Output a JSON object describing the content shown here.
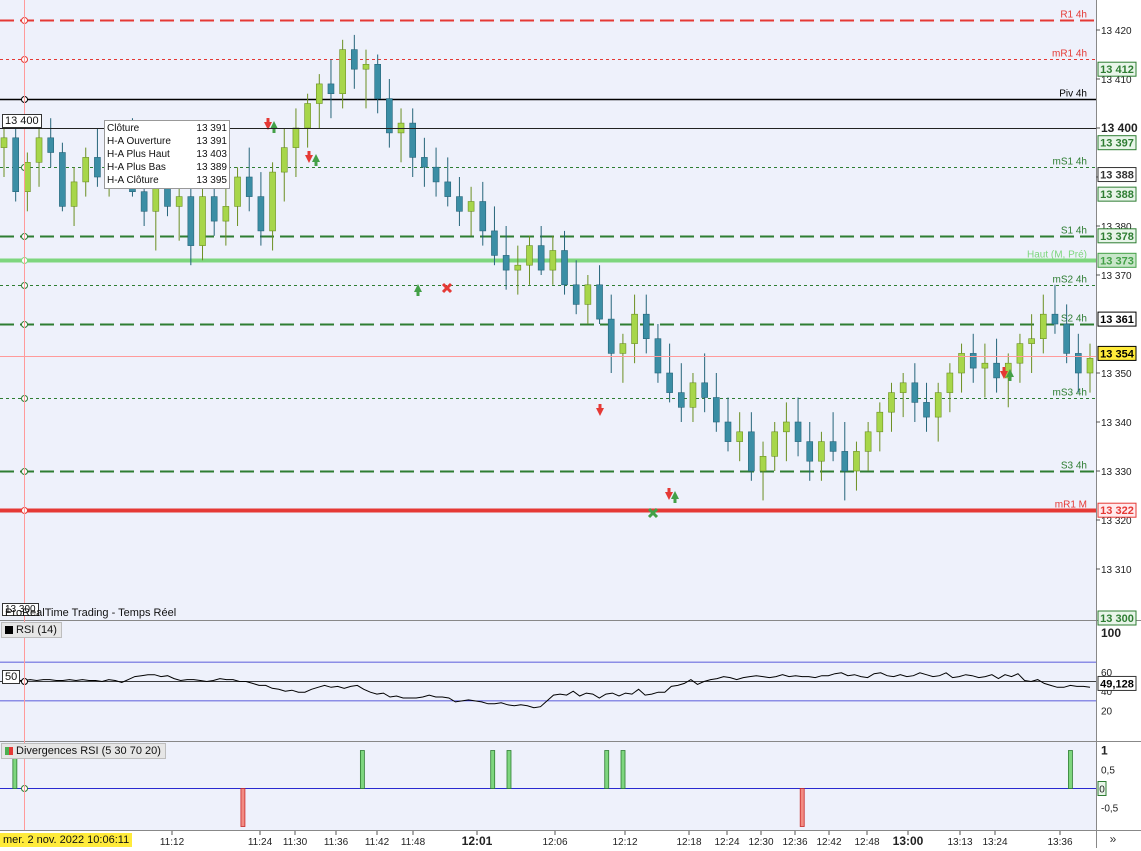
{
  "price_axis": {
    "ticks": [
      "13 420",
      "13 410",
      "13 400",
      "13 390",
      "13 380",
      "13 370",
      "13 350",
      "13 340",
      "13 330",
      "13 320",
      "13 310"
    ],
    "bold_tick": "13 400",
    "tags": [
      {
        "text": "13 412",
        "color": "#2e7d32",
        "bg": "#e8f5e9",
        "price": 13412
      },
      {
        "text": "13 397",
        "color": "#2e7d32",
        "bg": "#e8f5e9",
        "price": 13397
      },
      {
        "text": "13 388",
        "color": "#333333",
        "bg": "#ffffff",
        "price": 13390.5
      },
      {
        "text": "13 388",
        "color": "#2e7d32",
        "bg": "#e8f5e9",
        "price": 13386.5
      },
      {
        "text": "13 378",
        "color": "#2e7d32",
        "bg": "#e8f5e9",
        "price": 13378
      },
      {
        "text": "13 373",
        "color": "#43a047",
        "bg": "#c8e6c9",
        "price": 13373
      },
      {
        "text": "13 361",
        "color": "#000000",
        "bg": "#ffffff",
        "price": 13361
      },
      {
        "text": "13 354",
        "color": "#000000",
        "bg": "#ffeb3b",
        "price": 13354
      },
      {
        "text": "13 322",
        "color": "#e53935",
        "bg": "#ffebee",
        "price": 13322
      },
      {
        "text": "13 300",
        "color": "#2e7d32",
        "bg": "#e8f5e9",
        "price": 13300
      }
    ],
    "left_box": "13 400",
    "left_box_bottom": "13 300"
  },
  "levels": [
    {
      "label": "R1 4h",
      "price": 13422,
      "color": "#e53935",
      "style": "dashed-long",
      "width": 2
    },
    {
      "label": "mR1 4h",
      "price": 13414,
      "color": "#e53935",
      "style": "dotted",
      "width": 1
    },
    {
      "label": "Piv 4h",
      "price": 13406,
      "color": "#000000",
      "style": "solid",
      "width": 1.5
    },
    {
      "label": "mS1 4h",
      "price": 13392,
      "color": "#2e7d32",
      "style": "dotted",
      "width": 1
    },
    {
      "label": "S1 4h",
      "price": 13378,
      "color": "#2e7d32",
      "style": "dashed-long",
      "width": 2
    },
    {
      "label": "Haut (M, Pré)",
      "price": 13373,
      "color": "#7ed67e",
      "style": "solid",
      "width": 4
    },
    {
      "label": "mS2 4h",
      "price": 13368,
      "color": "#2e7d32",
      "style": "dotted",
      "width": 1
    },
    {
      "label": "S2 4h",
      "price": 13360,
      "color": "#2e7d32",
      "style": "dashed-long",
      "width": 2
    },
    {
      "label": "mS3 4h",
      "price": 13345,
      "color": "#2e7d32",
      "style": "dotted",
      "width": 1
    },
    {
      "label": "S3 4h",
      "price": 13330,
      "color": "#2e7d32",
      "style": "dashed-long",
      "width": 2
    },
    {
      "label": "mR1 M",
      "price": 13322,
      "color": "#e53935",
      "style": "solid",
      "width": 4
    }
  ],
  "tooltip": {
    "rows": [
      {
        "label": "Clôture",
        "value": "13 391"
      },
      {
        "label": "H-A Ouverture",
        "value": "13 391"
      },
      {
        "label": "H-A Plus Haut",
        "value": "13 403"
      },
      {
        "label": "H-A Plus Bas",
        "value": "13 389"
      },
      {
        "label": "H-A Clôture",
        "value": "13 395"
      }
    ]
  },
  "source_label": "ProRealTime Trading - Temps Réel",
  "rsi_panel": {
    "title": "RSI (14)",
    "ticks": [
      "100",
      "60",
      "40",
      "20"
    ],
    "left_box": "50",
    "current_value": "49,128",
    "overbought": 70,
    "oversold": 30,
    "midline": 50,
    "values": [
      51,
      50,
      51,
      51,
      52,
      51,
      52,
      52,
      51,
      51,
      52,
      51,
      52,
      51,
      51,
      50,
      52,
      51,
      49,
      52,
      55,
      56,
      57,
      57,
      55,
      56,
      53,
      51,
      52,
      52,
      51,
      50,
      51,
      53,
      52,
      52,
      50,
      50,
      48,
      46,
      46,
      43,
      42,
      40,
      41,
      39,
      39,
      42,
      44,
      46,
      44,
      45,
      43,
      45,
      46,
      42,
      39,
      37,
      38,
      34,
      35,
      33,
      33,
      33,
      34,
      36,
      34,
      34,
      33,
      29,
      30,
      31,
      30,
      29,
      27,
      27,
      28,
      26,
      25,
      26,
      25,
      23,
      24,
      30,
      36,
      37,
      36,
      40,
      35,
      38,
      37,
      33,
      37,
      38,
      35,
      38,
      37,
      42,
      36,
      37,
      39,
      39,
      45,
      46,
      48,
      52,
      47,
      50,
      52,
      53,
      55,
      54,
      52,
      54,
      55,
      56,
      55,
      54,
      55,
      57,
      55,
      56,
      55,
      55,
      54,
      56,
      56,
      58,
      59,
      56,
      57,
      55,
      54,
      58,
      59,
      56,
      55,
      57,
      55,
      56,
      59,
      57,
      55,
      56,
      59,
      54,
      55,
      57,
      56,
      54,
      55,
      57,
      53,
      57,
      55,
      58,
      51,
      50,
      52,
      48,
      46,
      44,
      44,
      46,
      45,
      45,
      44
    ]
  },
  "div_panel": {
    "title": "Divergences RSI (5 30 70 20)",
    "ticks": [
      "1",
      "0,5",
      "-0,5"
    ],
    "zero_box": "0",
    "bullish_times": [
      0.01,
      0.33,
      0.45,
      0.465,
      0.555,
      0.57,
      0.982
    ],
    "bearish_times": [
      0.22,
      0.735
    ]
  },
  "time_axis": {
    "ticks": [
      {
        "label": "11:12",
        "bold": false
      },
      {
        "label": "11:24",
        "bold": false
      },
      {
        "label": "11:30",
        "bold": false
      },
      {
        "label": "11:36",
        "bold": false
      },
      {
        "label": "11:42",
        "bold": false
      },
      {
        "label": "11:48",
        "bold": false
      },
      {
        "label": "12:01",
        "bold": true
      },
      {
        "label": "12:06",
        "bold": false
      },
      {
        "label": "12:12",
        "bold": false
      },
      {
        "label": "12:18",
        "bold": false
      },
      {
        "label": "12:24",
        "bold": false
      },
      {
        "label": "12:30",
        "bold": false
      },
      {
        "label": "12:36",
        "bold": false
      },
      {
        "label": "12:42",
        "bold": false
      },
      {
        "label": "12:48",
        "bold": false
      },
      {
        "label": "13:00",
        "bold": true
      },
      {
        "label": "13:13",
        "bold": false
      },
      {
        "label": "13:24",
        "bold": false
      },
      {
        "label": "13:36",
        "bold": false
      }
    ],
    "cursor_date": "mer. 2 nov. 2022 10:06:11",
    "more_label": "»"
  },
  "candles": [
    [
      13396,
      13401,
      13390,
      13398
    ],
    [
      13398,
      13400,
      13385,
      13387
    ],
    [
      13387,
      13395,
      13383,
      13393
    ],
    [
      13393,
      13400,
      13388,
      13398
    ],
    [
      13398,
      13402,
      13392,
      13395
    ],
    [
      13395,
      13397,
      13383,
      13384
    ],
    [
      13384,
      13392,
      13380,
      13389
    ],
    [
      13389,
      13396,
      13386,
      13394
    ],
    [
      13394,
      13400,
      13388,
      13390
    ],
    [
      13390,
      13398,
      13386,
      13396
    ],
    [
      13396,
      13401,
      13392,
      13399
    ],
    [
      13399,
      13402,
      13386,
      13387
    ],
    [
      13387,
      13392,
      13380,
      13383
    ],
    [
      13383,
      13390,
      13375,
      13388
    ],
    [
      13388,
      13392,
      13382,
      13384
    ],
    [
      13384,
      13390,
      13377,
      13386
    ],
    [
      13386,
      13392,
      13372,
      13376
    ],
    [
      13376,
      13388,
      13373,
      13386
    ],
    [
      13386,
      13392,
      13378,
      13381
    ],
    [
      13381,
      13388,
      13376,
      13384
    ],
    [
      13384,
      13392,
      13380,
      13390
    ],
    [
      13390,
      13396,
      13383,
      13386
    ],
    [
      13386,
      13391,
      13376,
      13379
    ],
    [
      13379,
      13393,
      13375,
      13391
    ],
    [
      13391,
      13400,
      13385,
      13396
    ],
    [
      13396,
      13404,
      13390,
      13400
    ],
    [
      13400,
      13407,
      13396,
      13405
    ],
    [
      13405,
      13411,
      13400,
      13409
    ],
    [
      13409,
      13414,
      13402,
      13407
    ],
    [
      13407,
      13418,
      13404,
      13416
    ],
    [
      13416,
      13419,
      13408,
      13412
    ],
    [
      13412,
      13416,
      13404,
      13413
    ],
    [
      13413,
      13415,
      13403,
      13406
    ],
    [
      13406,
      13410,
      13396,
      13399
    ],
    [
      13399,
      13404,
      13393,
      13401
    ],
    [
      13401,
      13404,
      13390,
      13394
    ],
    [
      13394,
      13398,
      13388,
      13392
    ],
    [
      13392,
      13396,
      13386,
      13389
    ],
    [
      13389,
      13394,
      13384,
      13386
    ],
    [
      13386,
      13390,
      13380,
      13383
    ],
    [
      13383,
      13388,
      13378,
      13385
    ],
    [
      13385,
      13389,
      13376,
      13379
    ],
    [
      13379,
      13384,
      13372,
      13374
    ],
    [
      13374,
      13380,
      13367,
      13371
    ],
    [
      13371,
      13376,
      13366,
      13372
    ],
    [
      13372,
      13378,
      13368,
      13376
    ],
    [
      13376,
      13380,
      13370,
      13371
    ],
    [
      13371,
      13378,
      13368,
      13375
    ],
    [
      13375,
      13379,
      13366,
      13368
    ],
    [
      13368,
      13373,
      13362,
      13364
    ],
    [
      13364,
      13370,
      13360,
      13368
    ],
    [
      13368,
      13372,
      13360,
      13361
    ],
    [
      13361,
      13366,
      13350,
      13354
    ],
    [
      13354,
      13358,
      13348,
      13356
    ],
    [
      13356,
      13366,
      13352,
      13362
    ],
    [
      13362,
      13366,
      13354,
      13357
    ],
    [
      13357,
      13360,
      13348,
      13350
    ],
    [
      13350,
      13356,
      13344,
      13346
    ],
    [
      13346,
      13352,
      13340,
      13343
    ],
    [
      13343,
      13350,
      13340,
      13348
    ],
    [
      13348,
      13354,
      13342,
      13345
    ],
    [
      13345,
      13350,
      13338,
      13340
    ],
    [
      13340,
      13345,
      13334,
      13336
    ],
    [
      13336,
      13342,
      13332,
      13338
    ],
    [
      13338,
      13342,
      13328,
      13330
    ],
    [
      13330,
      13336,
      13324,
      13333
    ],
    [
      13333,
      13340,
      13330,
      13338
    ],
    [
      13338,
      13344,
      13332,
      13340
    ],
    [
      13340,
      13345,
      13333,
      13336
    ],
    [
      13336,
      13340,
      13328,
      13332
    ],
    [
      13332,
      13338,
      13328,
      13336
    ],
    [
      13336,
      13342,
      13332,
      13334
    ],
    [
      13334,
      13340,
      13324,
      13330
    ],
    [
      13330,
      13336,
      13326,
      13334
    ],
    [
      13334,
      13340,
      13330,
      13338
    ],
    [
      13338,
      13344,
      13334,
      13342
    ],
    [
      13342,
      13348,
      13338,
      13346
    ],
    [
      13346,
      13350,
      13341,
      13348
    ],
    [
      13348,
      13352,
      13340,
      13344
    ],
    [
      13344,
      13348,
      13338,
      13341
    ],
    [
      13341,
      13348,
      13336,
      13346
    ],
    [
      13346,
      13352,
      13342,
      13350
    ],
    [
      13350,
      13356,
      13346,
      13354
    ],
    [
      13354,
      13358,
      13348,
      13351
    ],
    [
      13351,
      13356,
      13345,
      13352
    ],
    [
      13352,
      13357,
      13346,
      13349
    ],
    [
      13349,
      13354,
      13343,
      13352
    ],
    [
      13352,
      13358,
      13348,
      13356
    ],
    [
      13356,
      13362,
      13350,
      13357
    ],
    [
      13357,
      13366,
      13354,
      13362
    ],
    [
      13362,
      13368,
      13358,
      13360
    ],
    [
      13360,
      13364,
      13352,
      13354
    ],
    [
      13354,
      13358,
      13346,
      13350
    ],
    [
      13350,
      13356,
      13346,
      13353
    ]
  ]
}
